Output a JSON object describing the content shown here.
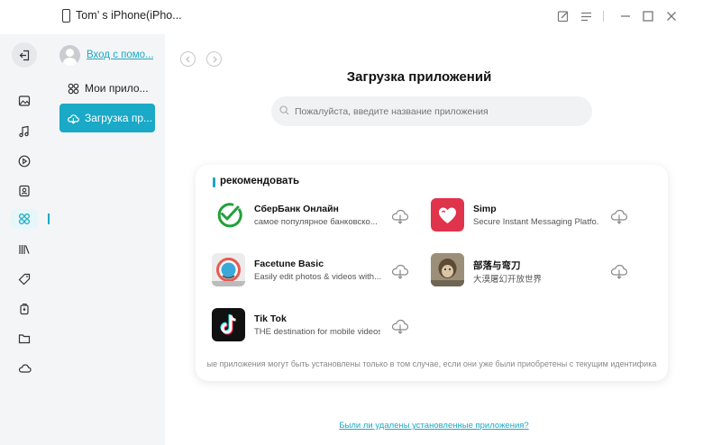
{
  "titlebar": {
    "device_name": "Tom’ s iPhone(iPho..."
  },
  "sidebar": {
    "icons": [
      "logout-icon",
      "photos-icon",
      "music-icon",
      "video-icon",
      "contacts-icon",
      "apps-icon",
      "books-icon",
      "ringtone-icon",
      "backup-icon",
      "files-icon",
      "cloud-icon"
    ],
    "active": "apps-icon"
  },
  "panel": {
    "help_link": "Вход с помо...",
    "items": [
      {
        "label": "Мои прило...",
        "icon": "apps-grid-icon"
      },
      {
        "label": "Загрузка пр...",
        "icon": "cloud-download-icon"
      }
    ]
  },
  "main": {
    "title": "Загрузка приложений",
    "search_placeholder": "Пожалуйста, введите название приложения",
    "section_title": "рекомендовать",
    "apps": [
      {
        "name": "СберБанк Онлайн",
        "desc": "самое популярное банковско..."
      },
      {
        "name": "Simp",
        "desc": "Secure Instant Messaging Platfo..."
      },
      {
        "name": "Facetune Basic",
        "desc": "Easily edit photos & videos with..."
      },
      {
        "name": "部落与弯刀",
        "desc": "大漠屠幻开放世界"
      },
      {
        "name": "Tik Tok",
        "desc": "THE destination for mobile videos"
      }
    ],
    "note": "ые приложения могут быть установлены только в том случае, если они уже были приобретены с текущим идентифика",
    "bottom_link": "Были ли удалены установленные приложения?"
  },
  "colors": {
    "accent": "#1aa9c6",
    "sber": "#21a038",
    "simp": "#e0334c"
  }
}
